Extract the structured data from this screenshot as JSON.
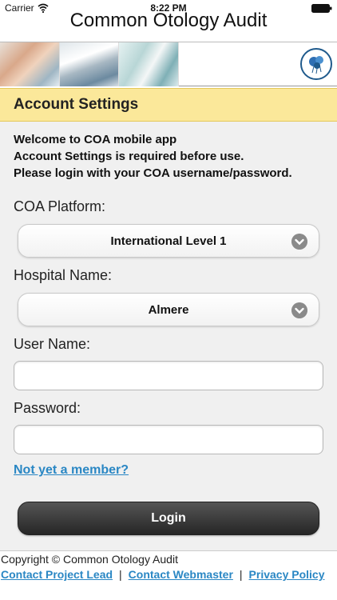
{
  "status_bar": {
    "carrier": "Carrier",
    "time": "8:22 PM"
  },
  "app": {
    "title": "Common Otology Audit"
  },
  "section": {
    "title": "Account Settings"
  },
  "welcome": {
    "line1": "Welcome to COA mobile app",
    "line2": "Account Settings is required before use.",
    "line3": "Please login with your COA username/password."
  },
  "form": {
    "platform_label": "COA Platform:",
    "platform_value": "International Level 1",
    "hospital_label": "Hospital Name:",
    "hospital_value": "Almere",
    "username_label": "User Name:",
    "username_value": "",
    "password_label": "Password:",
    "password_value": "",
    "member_link": "Not yet a member?",
    "login_label": "Login"
  },
  "footer": {
    "copyright": "Copyright © Common Otology Audit",
    "contact_lead": "Contact Project Lead",
    "separator": "|",
    "contact_webmaster": "Contact Webmaster",
    "privacy": "Privacy Policy"
  },
  "icons": {
    "wifi": "wifi-icon",
    "battery": "battery-icon",
    "logo": "coa-logo-icon",
    "chevron": "chevron-down-icon"
  },
  "colors": {
    "header_bg": "#fbe89a",
    "link": "#2a87c4",
    "button_dark": "#262626",
    "form_bg": "#f0f0f0"
  }
}
